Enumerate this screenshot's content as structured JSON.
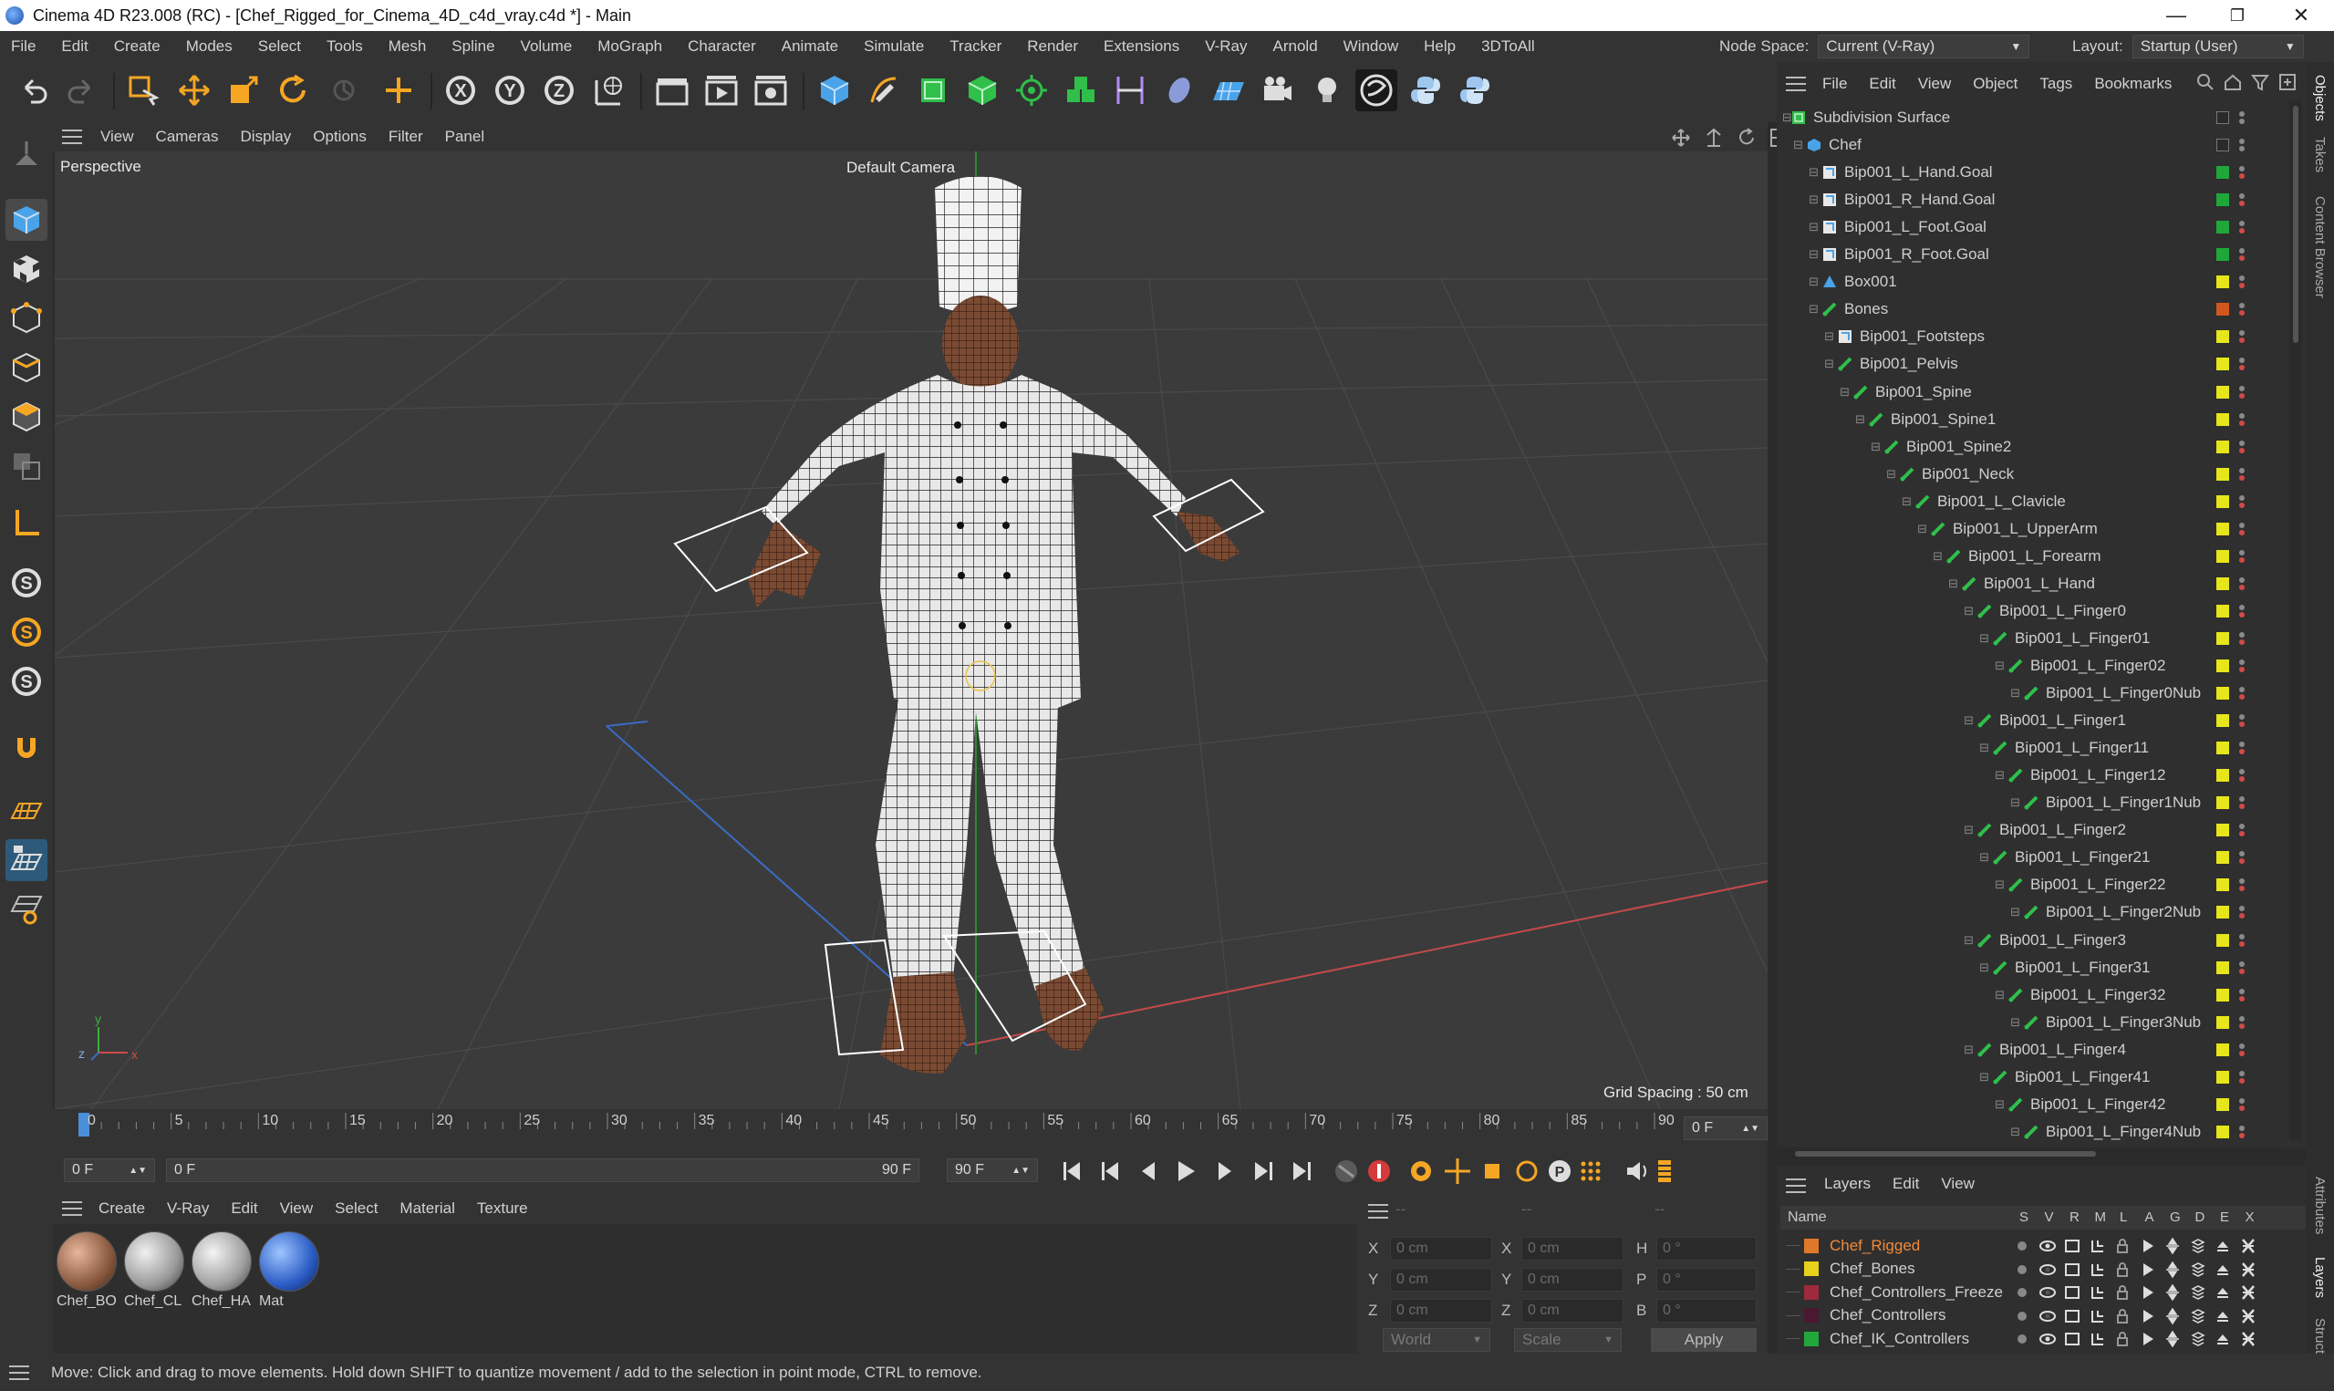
{
  "window": {
    "title": "Cinema 4D R23.008 (RC) - [Chef_Rigged_for_Cinema_4D_c4d_vray.c4d *] - Main",
    "min": "—",
    "max": "❐",
    "close": "✕"
  },
  "menubar": [
    "File",
    "Edit",
    "Create",
    "Modes",
    "Select",
    "Tools",
    "Mesh",
    "Spline",
    "Volume",
    "MoGraph",
    "Character",
    "Animate",
    "Simulate",
    "Tracker",
    "Render",
    "Extensions",
    "V-Ray",
    "Arnold",
    "Window",
    "Help",
    "3DToAll"
  ],
  "node_space": {
    "label": "Node Space:",
    "value": "Current (V-Ray)"
  },
  "layout": {
    "label": "Layout:",
    "value": "Startup (User)"
  },
  "viewport": {
    "menu": [
      "View",
      "Cameras",
      "Display",
      "Options",
      "Filter",
      "Panel"
    ],
    "projection": "Perspective",
    "camera": "Default Camera",
    "grid_spacing": "Grid Spacing : 50 cm",
    "axis_x": "x",
    "axis_y": "y",
    "axis_z": "z"
  },
  "timeline": {
    "ticks": [
      "0",
      "5",
      "10",
      "15",
      "20",
      "25",
      "30",
      "35",
      "40",
      "45",
      "50",
      "55",
      "60",
      "65",
      "70",
      "75",
      "80",
      "85",
      "90"
    ],
    "current_frame": "0 F",
    "start": "0 F",
    "range_start": "0 F",
    "range_end": "90 F",
    "end": "90 F"
  },
  "material_manager": {
    "menu": [
      "Create",
      "V-Ray",
      "Edit",
      "View",
      "Select",
      "Material",
      "Texture"
    ],
    "materials": [
      {
        "name": "Chef_BO"
      },
      {
        "name": "Chef_CL"
      },
      {
        "name": "Chef_HA"
      },
      {
        "name": "Mat"
      }
    ]
  },
  "coordinates": {
    "header_a": "--",
    "header_b": "--",
    "header_c": "--",
    "rows": [
      {
        "a": "X",
        "av": "0 cm",
        "b": "X",
        "bv": "0 cm",
        "c": "H",
        "cv": "0 °"
      },
      {
        "a": "Y",
        "av": "0 cm",
        "b": "Y",
        "bv": "0 cm",
        "c": "P",
        "cv": "0 °"
      },
      {
        "a": "Z",
        "av": "0 cm",
        "b": "Z",
        "bv": "0 cm",
        "c": "B",
        "cv": "0 °"
      }
    ],
    "world": "World",
    "scale": "Scale",
    "apply": "Apply"
  },
  "object_manager": {
    "menu": [
      "File",
      "Edit",
      "View",
      "Object",
      "Tags",
      "Bookmarks"
    ],
    "items": [
      {
        "label": "Subdivision Surface",
        "indent": 0,
        "icon": "sds",
        "color": "#2a2a2a"
      },
      {
        "label": "Chef",
        "indent": 1,
        "icon": "poly",
        "color": "#2a2a2a"
      },
      {
        "label": "Bip001_L_Hand.Goal",
        "indent": 2,
        "icon": "null",
        "color": "#1fa83a"
      },
      {
        "label": "Bip001_R_Hand.Goal",
        "indent": 2,
        "icon": "null",
        "color": "#1fa83a"
      },
      {
        "label": "Bip001_L_Foot.Goal",
        "indent": 2,
        "icon": "null",
        "color": "#1fa83a"
      },
      {
        "label": "Bip001_R_Foot.Goal",
        "indent": 2,
        "icon": "null",
        "color": "#1fa83a"
      },
      {
        "label": "Box001",
        "indent": 2,
        "icon": "tri",
        "color": "#e6e61a"
      },
      {
        "label": "Bones",
        "indent": 2,
        "icon": "bone",
        "color": "#d2571f"
      },
      {
        "label": "Bip001_Footsteps",
        "indent": 3,
        "icon": "null",
        "color": "#e6e61a"
      },
      {
        "label": "Bip001_Pelvis",
        "indent": 3,
        "icon": "bone",
        "color": "#e6e61a"
      },
      {
        "label": "Bip001_Spine",
        "indent": 4,
        "icon": "bone",
        "color": "#e6e61a"
      },
      {
        "label": "Bip001_Spine1",
        "indent": 5,
        "icon": "bone",
        "color": "#e6e61a"
      },
      {
        "label": "Bip001_Spine2",
        "indent": 6,
        "icon": "bone",
        "color": "#e6e61a"
      },
      {
        "label": "Bip001_Neck",
        "indent": 7,
        "icon": "bone",
        "color": "#e6e61a"
      },
      {
        "label": "Bip001_L_Clavicle",
        "indent": 8,
        "icon": "bone",
        "color": "#e6e61a"
      },
      {
        "label": "Bip001_L_UpperArm",
        "indent": 9,
        "icon": "bone",
        "color": "#e6e61a"
      },
      {
        "label": "Bip001_L_Forearm",
        "indent": 10,
        "icon": "bone",
        "color": "#e6e61a"
      },
      {
        "label": "Bip001_L_Hand",
        "indent": 11,
        "icon": "bone",
        "color": "#e6e61a"
      },
      {
        "label": "Bip001_L_Finger0",
        "indent": 12,
        "icon": "bone",
        "color": "#e6e61a"
      },
      {
        "label": "Bip001_L_Finger01",
        "indent": 13,
        "icon": "bone",
        "color": "#e6e61a"
      },
      {
        "label": "Bip001_L_Finger02",
        "indent": 14,
        "icon": "bone",
        "color": "#e6e61a"
      },
      {
        "label": "Bip001_L_Finger0Nub",
        "indent": 15,
        "icon": "bone",
        "color": "#e6e61a"
      },
      {
        "label": "Bip001_L_Finger1",
        "indent": 12,
        "icon": "bone",
        "color": "#e6e61a"
      },
      {
        "label": "Bip001_L_Finger11",
        "indent": 13,
        "icon": "bone",
        "color": "#e6e61a"
      },
      {
        "label": "Bip001_L_Finger12",
        "indent": 14,
        "icon": "bone",
        "color": "#e6e61a"
      },
      {
        "label": "Bip001_L_Finger1Nub",
        "indent": 15,
        "icon": "bone",
        "color": "#e6e61a"
      },
      {
        "label": "Bip001_L_Finger2",
        "indent": 12,
        "icon": "bone",
        "color": "#e6e61a"
      },
      {
        "label": "Bip001_L_Finger21",
        "indent": 13,
        "icon": "bone",
        "color": "#e6e61a"
      },
      {
        "label": "Bip001_L_Finger22",
        "indent": 14,
        "icon": "bone",
        "color": "#e6e61a"
      },
      {
        "label": "Bip001_L_Finger2Nub",
        "indent": 15,
        "icon": "bone",
        "color": "#e6e61a"
      },
      {
        "label": "Bip001_L_Finger3",
        "indent": 12,
        "icon": "bone",
        "color": "#e6e61a"
      },
      {
        "label": "Bip001_L_Finger31",
        "indent": 13,
        "icon": "bone",
        "color": "#e6e61a"
      },
      {
        "label": "Bip001_L_Finger32",
        "indent": 14,
        "icon": "bone",
        "color": "#e6e61a"
      },
      {
        "label": "Bip001_L_Finger3Nub",
        "indent": 15,
        "icon": "bone",
        "color": "#e6e61a"
      },
      {
        "label": "Bip001_L_Finger4",
        "indent": 12,
        "icon": "bone",
        "color": "#e6e61a"
      },
      {
        "label": "Bip001_L_Finger41",
        "indent": 13,
        "icon": "bone",
        "color": "#e6e61a"
      },
      {
        "label": "Bip001_L_Finger42",
        "indent": 14,
        "icon": "bone",
        "color": "#e6e61a"
      },
      {
        "label": "Bip001_L_Finger4Nub",
        "indent": 15,
        "icon": "bone",
        "color": "#e6e61a"
      }
    ]
  },
  "layer_manager": {
    "menu": [
      "Layers",
      "Edit",
      "View"
    ],
    "name_header": "Name",
    "columns": [
      "S",
      "V",
      "R",
      "M",
      "L",
      "A",
      "G",
      "D",
      "E",
      "X"
    ],
    "layers": [
      {
        "name": "Chef_Rigged",
        "color": "#e0782a",
        "active": true
      },
      {
        "name": "Chef_Bones",
        "color": "#e6d21a",
        "active": false
      },
      {
        "name": "Chef_Controllers_Freeze",
        "color": "#9e2a3c",
        "active": false
      },
      {
        "name": "Chef_Controllers",
        "color": "#4a1830",
        "active": false
      },
      {
        "name": "Chef_IK_Controllers",
        "color": "#22a83a",
        "active": false
      }
    ]
  },
  "right_tabs": [
    "Objects",
    "Takes",
    "Content Browser",
    "Attributes",
    "Layers",
    "Structure"
  ],
  "status": "Move: Click and drag to move elements. Hold down SHIFT to quantize movement / add to the selection in point mode, CTRL to remove."
}
